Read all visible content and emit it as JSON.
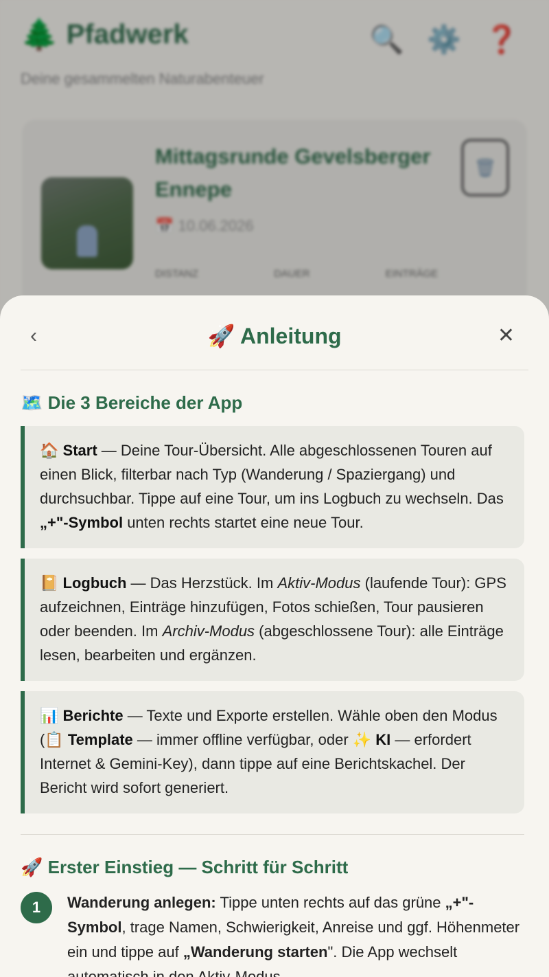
{
  "background": {
    "app_title": "Pfadwerk",
    "subtitle": "Deine gesammelten Naturabenteuer",
    "card": {
      "title": "Mittagsrunde Gevelsberger Ennepe",
      "date": "10.06.2026",
      "stats": [
        "DISTANZ",
        "DAUER",
        "EINTRÄGE"
      ]
    }
  },
  "sheet": {
    "title": "🚀 Anleitung",
    "section1": "🗺️ Die 3 Bereiche der App",
    "cards": {
      "start": {
        "icon": "🏠",
        "name": "Start",
        "t1": " — Deine Tour-Übersicht. Alle abgeschlossenen Touren auf einen Blick, filterbar nach Typ (Wanderung / Spaziergang) und durchsuchbar. Tippe auf eine Tour, um ins Logbuch zu wechseln. Das ",
        "bold2": "„+\"-Symbol",
        "t2": " unten rechts startet eine neue Tour."
      },
      "logbuch": {
        "icon": "📔",
        "name": "Logbuch",
        "t1": " — Das Herzstück. Im ",
        "it1": "Aktiv-Modus",
        "t2": " (laufende Tour): GPS aufzeichnen, Einträge hinzufügen, Fotos schießen, Tour pausieren oder beenden. Im ",
        "it2": "Archiv-Modus",
        "t3": " (abgeschlossene Tour): alle Einträge lesen, bearbeiten und ergänzen."
      },
      "berichte": {
        "icon": "📊",
        "name": "Berichte",
        "t1": " — Texte und Exporte erstellen. Wähle oben den Modus (📋 ",
        "bold2": "Template",
        "t2": " — immer offline verfügbar, oder ✨ ",
        "bold3": "KI",
        "t3": " — erfordert Internet & Gemini-Key), dann tippe auf eine Berichtskachel. Der Bericht wird sofort generiert."
      }
    },
    "section2": "🚀 Erster Einstieg — Schritt für Schritt",
    "step1": {
      "num": "1",
      "bold1": "Wanderung anlegen:",
      "t1": " Tippe unten rechts auf das grüne ",
      "bold2": "„+\"-Symbol",
      "t2": ", trage Namen, Schwierigkeit, Anreise und ggf. Höhenmeter ein und tippe auf ",
      "bold3": "„Wanderung starten",
      "t3": "\". Die App wechselt automatisch in den Aktiv-Modus."
    }
  }
}
